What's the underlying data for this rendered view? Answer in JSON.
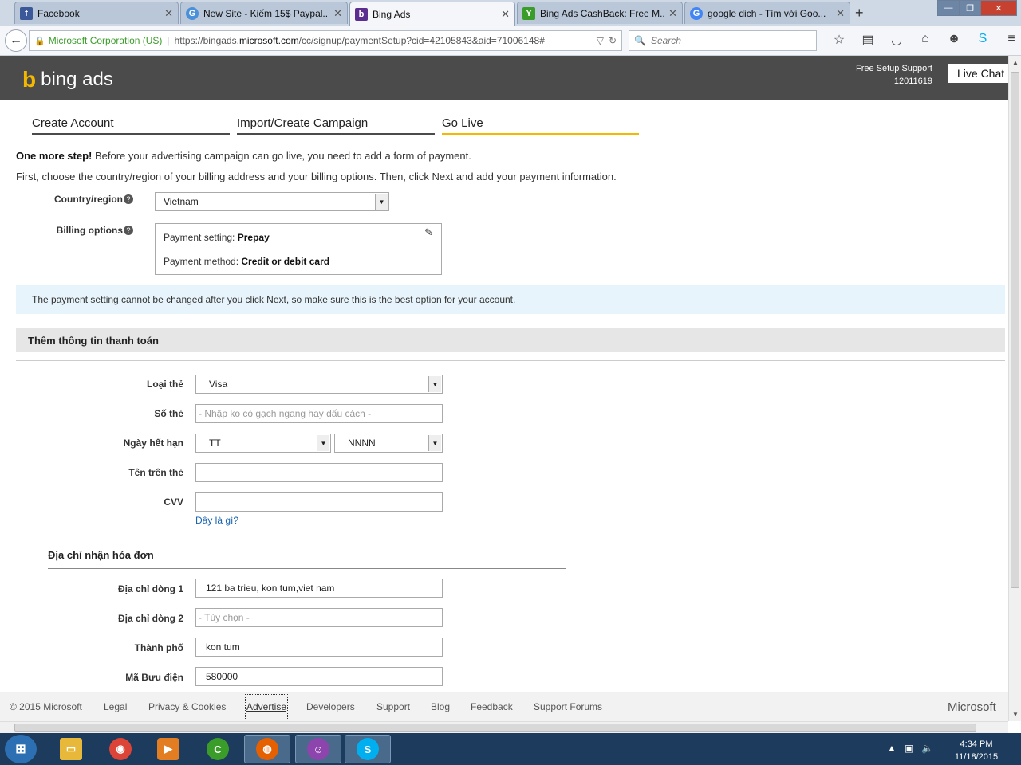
{
  "browser": {
    "tabs": [
      {
        "label": "Facebook",
        "icon": "facebook-icon",
        "color": "#3b5998"
      },
      {
        "label": "New Site - Kiếm 15$ Paypal...",
        "icon": "site-icon",
        "color": "#4a90d9"
      },
      {
        "label": "Bing Ads",
        "icon": "bing-icon",
        "color": "#5c2d91"
      },
      {
        "label": "Bing Ads CashBack: Free M...",
        "icon": "leaf-icon",
        "color": "#3a9d2a"
      },
      {
        "label": "google dich - Tìm với Goo...",
        "icon": "google-icon",
        "color": "#4285f4"
      }
    ],
    "url_org": "Microsoft Corporation (US)",
    "url_prefix": "https://bingads.",
    "url_domain": "microsoft.com",
    "url_rest": "/cc/signup/paymentSetup?cid=42105843&aid=71006148#",
    "search_placeholder": "Search"
  },
  "header": {
    "logo_text": "bing ads",
    "support_line1": "Free Setup Support",
    "support_line2": "12011619",
    "live_chat": "Live Chat"
  },
  "steps": [
    "Create Account",
    "Import/Create Campaign",
    "Go Live"
  ],
  "intro": {
    "bold": "One more step!",
    "rest": " Before your advertising campaign can go live, you need to add a form of payment.",
    "line2": "First, choose the country/region of your billing address and your billing options. Then, click Next and add your payment information."
  },
  "country": {
    "label": "Country/region",
    "value": "Vietnam"
  },
  "billing": {
    "label": "Billing options",
    "setting_label": "Payment setting: ",
    "setting_value": "Prepay",
    "method_label": "Payment method: ",
    "method_value": "Credit or debit card"
  },
  "notice": "The payment setting cannot be changed after you click Next, so make sure this is the best option for your account.",
  "payment_section": {
    "title": "Thêm thông tin thanh toán",
    "card_type_label": "Loại thẻ",
    "card_type_value": "Visa",
    "card_number_label": "Số thẻ",
    "card_number_placeholder": "- Nhập ko có gạch ngang hay dấu cách -",
    "expiry_label": "Ngày hết hạn",
    "expiry_month": "TT",
    "expiry_year": "NNNN",
    "name_label": "Tên trên thẻ",
    "cvv_label": "CVV",
    "cvv_help": "Đây là gì?"
  },
  "address_section": {
    "title": "Địa chỉ nhận hóa đơn",
    "line1_label": "Địa chỉ dòng 1",
    "line1_value": "121 ba trieu, kon tum,viet nam",
    "line2_label": "Địa chỉ dòng 2",
    "line2_placeholder": "- Tùy chọn -",
    "city_label": "Thành phố",
    "city_value": "kon tum",
    "postal_label": "Mã Bưu điện",
    "postal_value": "580000"
  },
  "footer": {
    "copyright": "© 2015 Microsoft",
    "links": [
      "Legal",
      "Privacy & Cookies",
      "Advertise",
      "Developers",
      "Support",
      "Blog",
      "Feedback",
      "Support Forums"
    ],
    "brand": "Microsoft"
  },
  "taskbar": {
    "time": "4:34 PM",
    "date": "11/18/2015"
  },
  "colors": {
    "accent": "#f5b800",
    "header_bg": "#4b4b4b",
    "link": "#1a64b0"
  }
}
